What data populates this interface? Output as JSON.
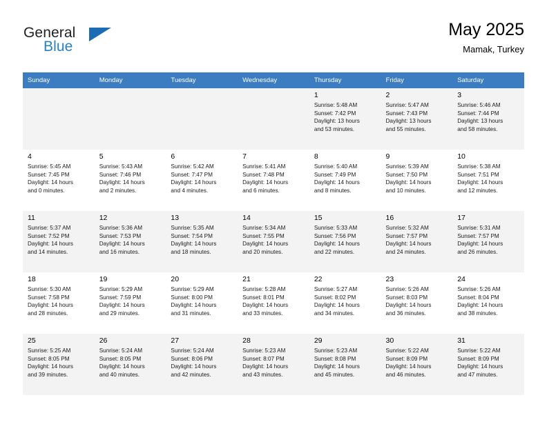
{
  "brand": {
    "name_part1": "General",
    "name_part2": "Blue",
    "triangle_color": "#1b6cb5",
    "blue_color": "#2580c9"
  },
  "header": {
    "title": "May 2025",
    "subtitle": "Mamak, Turkey"
  },
  "theme": {
    "header_row_bg": "#3b7dc0",
    "header_row_text": "#ffffff",
    "shaded_row_bg": "#f3f3f3",
    "grid_line": "#cfcfcf"
  },
  "weekday_headers": [
    "Sunday",
    "Monday",
    "Tuesday",
    "Wednesday",
    "Thursday",
    "Friday",
    "Saturday"
  ],
  "weeks": [
    {
      "shaded": true,
      "days": [
        {
          "num": "",
          "sunrise": "",
          "sunset": "",
          "daylight1": "",
          "daylight2": ""
        },
        {
          "num": "",
          "sunrise": "",
          "sunset": "",
          "daylight1": "",
          "daylight2": ""
        },
        {
          "num": "",
          "sunrise": "",
          "sunset": "",
          "daylight1": "",
          "daylight2": ""
        },
        {
          "num": "",
          "sunrise": "",
          "sunset": "",
          "daylight1": "",
          "daylight2": ""
        },
        {
          "num": "1",
          "sunrise": "Sunrise: 5:48 AM",
          "sunset": "Sunset: 7:42 PM",
          "daylight1": "Daylight: 13 hours",
          "daylight2": "and 53 minutes."
        },
        {
          "num": "2",
          "sunrise": "Sunrise: 5:47 AM",
          "sunset": "Sunset: 7:43 PM",
          "daylight1": "Daylight: 13 hours",
          "daylight2": "and 55 minutes."
        },
        {
          "num": "3",
          "sunrise": "Sunrise: 5:46 AM",
          "sunset": "Sunset: 7:44 PM",
          "daylight1": "Daylight: 13 hours",
          "daylight2": "and 58 minutes."
        }
      ]
    },
    {
      "shaded": false,
      "days": [
        {
          "num": "4",
          "sunrise": "Sunrise: 5:45 AM",
          "sunset": "Sunset: 7:45 PM",
          "daylight1": "Daylight: 14 hours",
          "daylight2": "and 0 minutes."
        },
        {
          "num": "5",
          "sunrise": "Sunrise: 5:43 AM",
          "sunset": "Sunset: 7:46 PM",
          "daylight1": "Daylight: 14 hours",
          "daylight2": "and 2 minutes."
        },
        {
          "num": "6",
          "sunrise": "Sunrise: 5:42 AM",
          "sunset": "Sunset: 7:47 PM",
          "daylight1": "Daylight: 14 hours",
          "daylight2": "and 4 minutes."
        },
        {
          "num": "7",
          "sunrise": "Sunrise: 5:41 AM",
          "sunset": "Sunset: 7:48 PM",
          "daylight1": "Daylight: 14 hours",
          "daylight2": "and 6 minutes."
        },
        {
          "num": "8",
          "sunrise": "Sunrise: 5:40 AM",
          "sunset": "Sunset: 7:49 PM",
          "daylight1": "Daylight: 14 hours",
          "daylight2": "and 8 minutes."
        },
        {
          "num": "9",
          "sunrise": "Sunrise: 5:39 AM",
          "sunset": "Sunset: 7:50 PM",
          "daylight1": "Daylight: 14 hours",
          "daylight2": "and 10 minutes."
        },
        {
          "num": "10",
          "sunrise": "Sunrise: 5:38 AM",
          "sunset": "Sunset: 7:51 PM",
          "daylight1": "Daylight: 14 hours",
          "daylight2": "and 12 minutes."
        }
      ]
    },
    {
      "shaded": true,
      "days": [
        {
          "num": "11",
          "sunrise": "Sunrise: 5:37 AM",
          "sunset": "Sunset: 7:52 PM",
          "daylight1": "Daylight: 14 hours",
          "daylight2": "and 14 minutes."
        },
        {
          "num": "12",
          "sunrise": "Sunrise: 5:36 AM",
          "sunset": "Sunset: 7:53 PM",
          "daylight1": "Daylight: 14 hours",
          "daylight2": "and 16 minutes."
        },
        {
          "num": "13",
          "sunrise": "Sunrise: 5:35 AM",
          "sunset": "Sunset: 7:54 PM",
          "daylight1": "Daylight: 14 hours",
          "daylight2": "and 18 minutes."
        },
        {
          "num": "14",
          "sunrise": "Sunrise: 5:34 AM",
          "sunset": "Sunset: 7:55 PM",
          "daylight1": "Daylight: 14 hours",
          "daylight2": "and 20 minutes."
        },
        {
          "num": "15",
          "sunrise": "Sunrise: 5:33 AM",
          "sunset": "Sunset: 7:56 PM",
          "daylight1": "Daylight: 14 hours",
          "daylight2": "and 22 minutes."
        },
        {
          "num": "16",
          "sunrise": "Sunrise: 5:32 AM",
          "sunset": "Sunset: 7:57 PM",
          "daylight1": "Daylight: 14 hours",
          "daylight2": "and 24 minutes."
        },
        {
          "num": "17",
          "sunrise": "Sunrise: 5:31 AM",
          "sunset": "Sunset: 7:57 PM",
          "daylight1": "Daylight: 14 hours",
          "daylight2": "and 26 minutes."
        }
      ]
    },
    {
      "shaded": false,
      "days": [
        {
          "num": "18",
          "sunrise": "Sunrise: 5:30 AM",
          "sunset": "Sunset: 7:58 PM",
          "daylight1": "Daylight: 14 hours",
          "daylight2": "and 28 minutes."
        },
        {
          "num": "19",
          "sunrise": "Sunrise: 5:29 AM",
          "sunset": "Sunset: 7:59 PM",
          "daylight1": "Daylight: 14 hours",
          "daylight2": "and 29 minutes."
        },
        {
          "num": "20",
          "sunrise": "Sunrise: 5:29 AM",
          "sunset": "Sunset: 8:00 PM",
          "daylight1": "Daylight: 14 hours",
          "daylight2": "and 31 minutes."
        },
        {
          "num": "21",
          "sunrise": "Sunrise: 5:28 AM",
          "sunset": "Sunset: 8:01 PM",
          "daylight1": "Daylight: 14 hours",
          "daylight2": "and 33 minutes."
        },
        {
          "num": "22",
          "sunrise": "Sunrise: 5:27 AM",
          "sunset": "Sunset: 8:02 PM",
          "daylight1": "Daylight: 14 hours",
          "daylight2": "and 34 minutes."
        },
        {
          "num": "23",
          "sunrise": "Sunrise: 5:26 AM",
          "sunset": "Sunset: 8:03 PM",
          "daylight1": "Daylight: 14 hours",
          "daylight2": "and 36 minutes."
        },
        {
          "num": "24",
          "sunrise": "Sunrise: 5:26 AM",
          "sunset": "Sunset: 8:04 PM",
          "daylight1": "Daylight: 14 hours",
          "daylight2": "and 38 minutes."
        }
      ]
    },
    {
      "shaded": true,
      "days": [
        {
          "num": "25",
          "sunrise": "Sunrise: 5:25 AM",
          "sunset": "Sunset: 8:05 PM",
          "daylight1": "Daylight: 14 hours",
          "daylight2": "and 39 minutes."
        },
        {
          "num": "26",
          "sunrise": "Sunrise: 5:24 AM",
          "sunset": "Sunset: 8:05 PM",
          "daylight1": "Daylight: 14 hours",
          "daylight2": "and 40 minutes."
        },
        {
          "num": "27",
          "sunrise": "Sunrise: 5:24 AM",
          "sunset": "Sunset: 8:06 PM",
          "daylight1": "Daylight: 14 hours",
          "daylight2": "and 42 minutes."
        },
        {
          "num": "28",
          "sunrise": "Sunrise: 5:23 AM",
          "sunset": "Sunset: 8:07 PM",
          "daylight1": "Daylight: 14 hours",
          "daylight2": "and 43 minutes."
        },
        {
          "num": "29",
          "sunrise": "Sunrise: 5:23 AM",
          "sunset": "Sunset: 8:08 PM",
          "daylight1": "Daylight: 14 hours",
          "daylight2": "and 45 minutes."
        },
        {
          "num": "30",
          "sunrise": "Sunrise: 5:22 AM",
          "sunset": "Sunset: 8:09 PM",
          "daylight1": "Daylight: 14 hours",
          "daylight2": "and 46 minutes."
        },
        {
          "num": "31",
          "sunrise": "Sunrise: 5:22 AM",
          "sunset": "Sunset: 8:09 PM",
          "daylight1": "Daylight: 14 hours",
          "daylight2": "and 47 minutes."
        }
      ]
    }
  ]
}
